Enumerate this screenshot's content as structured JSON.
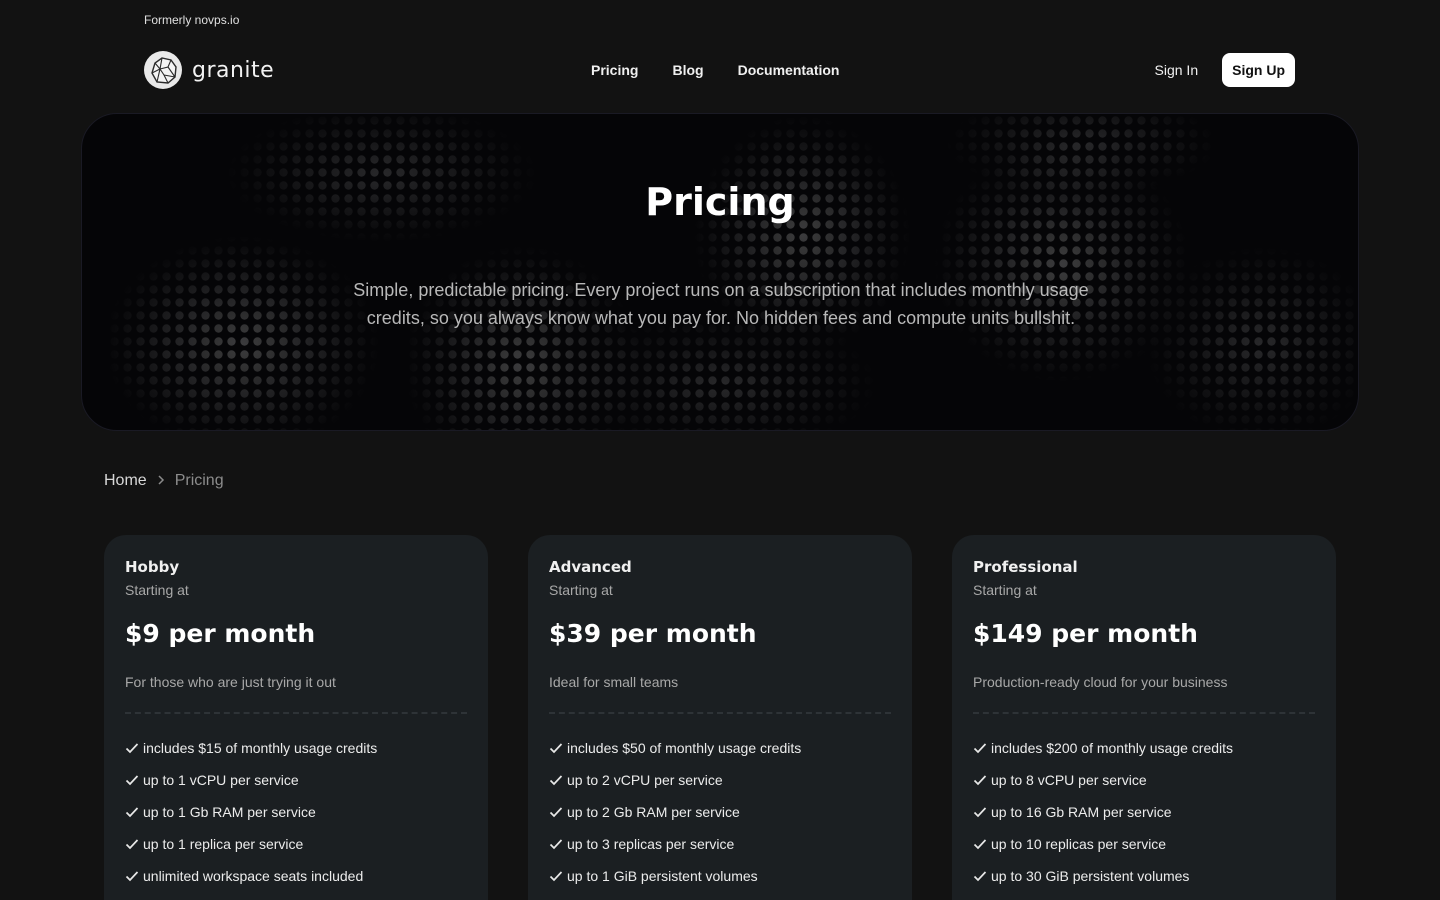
{
  "top_note": "Formerly novps.io",
  "brand": {
    "name": "granite"
  },
  "nav": {
    "links": [
      "Pricing",
      "Blog",
      "Documentation"
    ],
    "sign_in": "Sign In",
    "sign_up": "Sign Up"
  },
  "hero": {
    "title": "Pricing",
    "subtitle": "Simple, predictable pricing. Every project runs on a subscription that includes monthly usage credits, so you always know what you pay for. No hidden fees and compute units bullshit."
  },
  "breadcrumb": {
    "home": "Home",
    "separator": "chevron-right-icon",
    "current": "Pricing"
  },
  "plans": [
    {
      "name": "Hobby",
      "starting": "Starting at",
      "price": "$9 per month",
      "description": "For those who are just trying it out",
      "features": [
        "includes $15 of monthly usage credits",
        "up to 1 vCPU per service",
        "up to 1 Gb RAM per service",
        "up to 1 replica per service",
        "unlimited workspace seats included"
      ]
    },
    {
      "name": "Advanced",
      "starting": "Starting at",
      "price": "$39 per month",
      "description": "Ideal for small teams",
      "features": [
        "includes $50 of monthly usage credits",
        "up to 2 vCPU per service",
        "up to 2 Gb RAM per service",
        "up to 3 replicas per service",
        "up to 1 GiB persistent volumes"
      ]
    },
    {
      "name": "Professional",
      "starting": "Starting at",
      "price": "$149 per month",
      "description": "Production-ready cloud for your business",
      "features": [
        "includes $200 of monthly usage credits",
        "up to 8 vCPU per service",
        "up to 16 Gb RAM per service",
        "up to 10 replicas per service",
        "up to 30 GiB persistent volumes"
      ]
    }
  ],
  "colors": {
    "background": "#121212",
    "card": "#1b1f22",
    "hero": "#050507",
    "signup_button": "#ffffff"
  }
}
